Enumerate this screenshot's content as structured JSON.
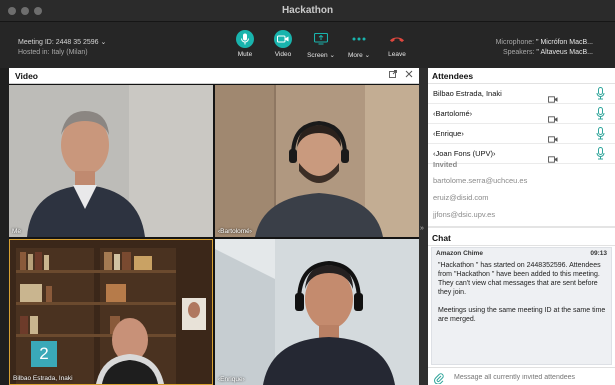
{
  "window": {
    "title": "Hackathon"
  },
  "meeting": {
    "id_text": "Meeting ID: 2448 35 2596 ⌄",
    "hosted_text": "Hosted in: Italy (Milan)"
  },
  "toolbar": {
    "mute_label": "Mute",
    "video_label": "Video",
    "screen_label": "Screen ⌄",
    "more_label": "More ⌄",
    "leave_label": "Leave"
  },
  "devices": {
    "microphone_label": "Microphone:",
    "microphone_value": "\" Micrófon MacB...",
    "speakers_label": "Speakers:",
    "speakers_value": "\" Altaveus MacB..."
  },
  "video": {
    "title": "Video",
    "tiles": [
      {
        "label": "Me"
      },
      {
        "label": "‹Bartolomé›"
      },
      {
        "label": "Bilbao Estrada, Inaki"
      },
      {
        "label": "‹Enrique›"
      }
    ],
    "badge": "2"
  },
  "attendees": {
    "title": "Attendees",
    "list": [
      {
        "name": "Bilbao Estrada, Inaki"
      },
      {
        "name": "‹Bartolomé›"
      },
      {
        "name": "‹Enrique›"
      },
      {
        "name": "‹Joan Fons (UPV)›"
      }
    ],
    "invited_title": "Invited",
    "invited": [
      "bartolome.serra@uchceu.es",
      "eruiz@disid.com",
      "jjfons@dsic.upv.es"
    ]
  },
  "chat": {
    "title": "Chat",
    "sender": "Amazon Chime",
    "time": "09:13",
    "message_p1": "\"Hackathon \" has started on 2448352596. Attendees from \"Hackathon \" have been added to this meeting. They can't view chat messages that are sent before they join.",
    "message_p2": "Meetings using the same meeting ID at the same time are merged.",
    "input_placeholder": "Message all currently invited attendees"
  },
  "colors": {
    "accent": "#19b4ad",
    "leave": "#e0473e",
    "badge": "#3aa9b8",
    "mic_green": "#2fa59b"
  }
}
